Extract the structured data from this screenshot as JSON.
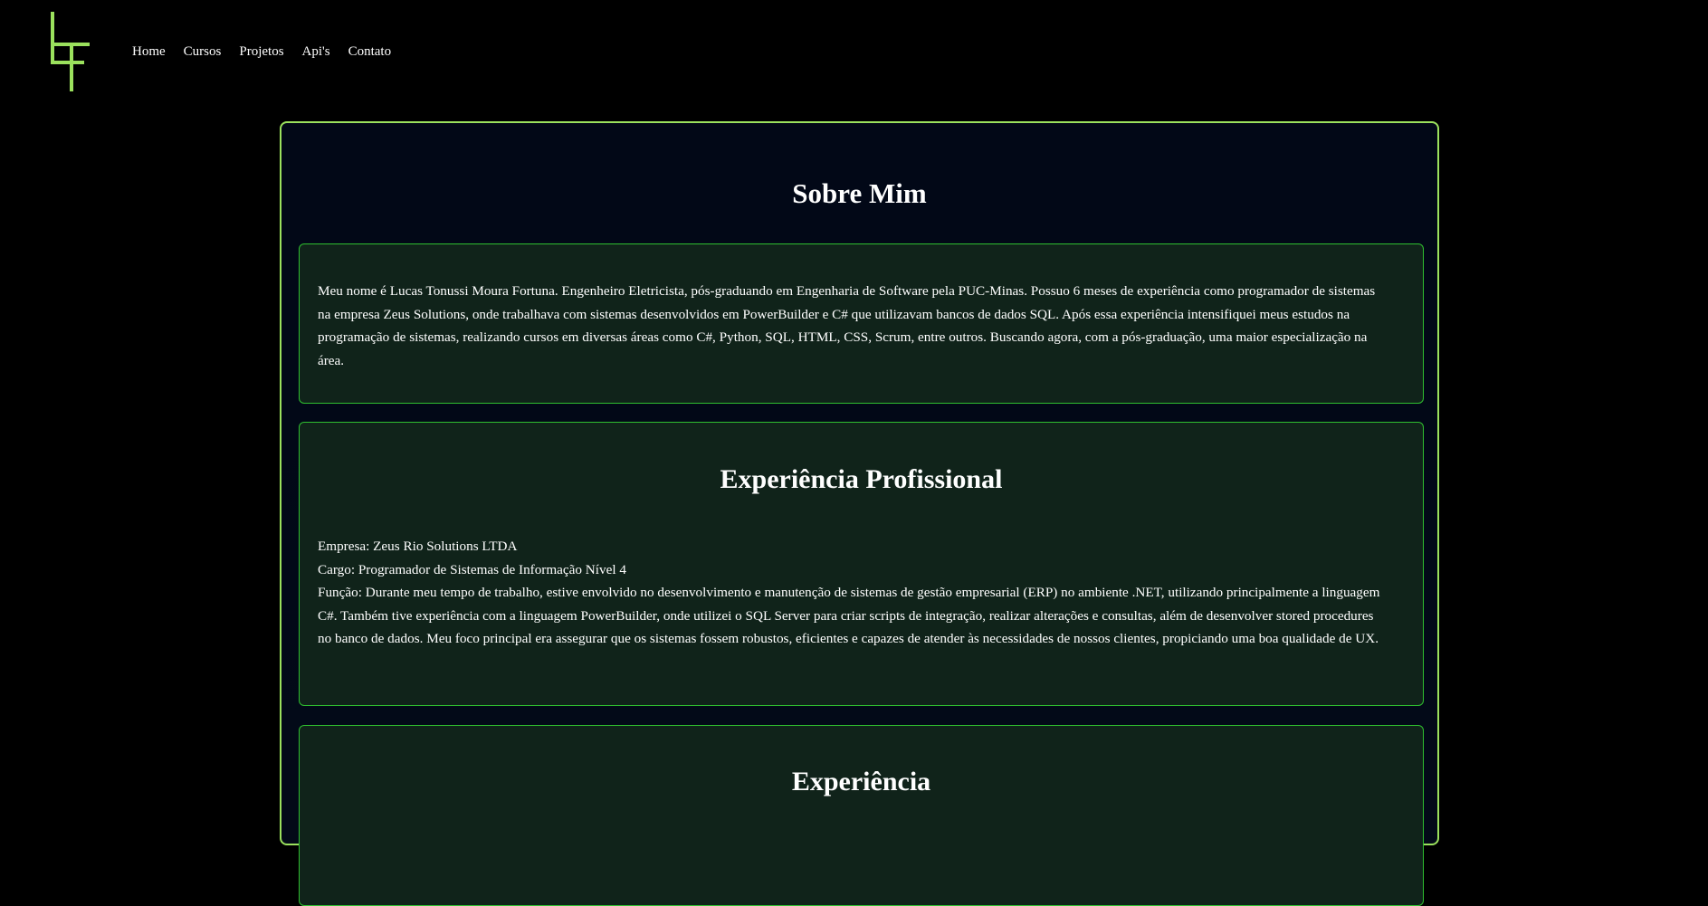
{
  "header": {
    "logo_icon": "lt-monogram-logo",
    "logo_color": "#9be15d",
    "nav": [
      {
        "label": "Home"
      },
      {
        "label": "Cursos"
      },
      {
        "label": "Projetos"
      },
      {
        "label": "Api's"
      },
      {
        "label": "Contato"
      }
    ]
  },
  "main": {
    "title": "Sobre Mim",
    "about": {
      "text": "Meu nome é Lucas Tonussi Moura Fortuna. Engenheiro Eletricista, pós-graduando em Engenharia de Software pela PUC-Minas. Possuo 6 meses de experiência como programador de sistemas na empresa Zeus Solutions, onde trabalhava com sistemas desenvolvidos em PowerBuilder e C# que utilizavam bancos de dados SQL. Após essa experiência intensifiquei meus estudos na programação de sistemas, realizando cursos em diversas áreas como C#, Python, SQL, HTML, CSS, Scrum, entre outros. Buscando agora, com a pós-graduação, uma maior especialização na área."
    },
    "experience": {
      "title": "Experiência Profissional",
      "company": "Empresa: Zeus Rio Solutions LTDA",
      "role": "Cargo: Programador de Sistemas de Informação Nível 4",
      "function": "Função: Durante meu tempo de trabalho, estive envolvido no desenvolvimento e manutenção de sistemas de gestão empresarial (ERP) no ambiente .NET, utilizando principalmente a linguagem C#. Também tive experiência com a linguagem PowerBuilder, onde utilizei o SQL Server para criar scripts de integração, realizar alterações e consultas, além de desenvolver stored procedures no banco de dados. Meu foco principal era assegurar que os sistemas fossem robustos, eficientes e capazes de atender às necessidades de nossos clientes, propiciando uma boa qualidade de UX."
    },
    "third_section": {
      "title": "Experiência"
    }
  },
  "colors": {
    "background": "#000000",
    "accent_border": "#9be15d",
    "card_border": "#2fbf2f",
    "card_background": "#10231a",
    "panel_background": "#020817"
  }
}
